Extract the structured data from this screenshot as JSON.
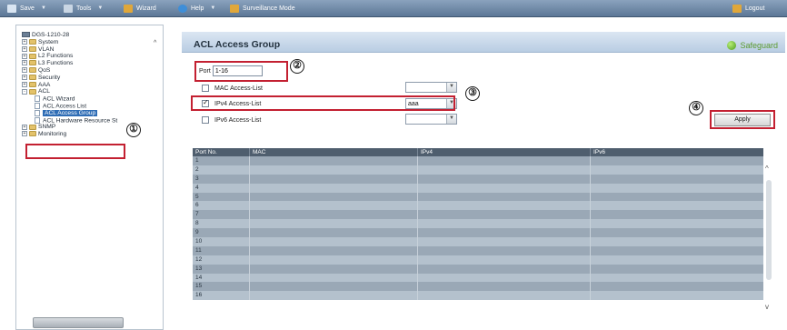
{
  "toolbar": {
    "save": "Save",
    "tools": "Tools",
    "wizard": "Wizard",
    "help": "Help",
    "surveillance": "Surveillance Mode",
    "logout": "Logout"
  },
  "tree": [
    {
      "label": "DGS-1210-28",
      "indent": 0,
      "icon": "device"
    },
    {
      "label": "System",
      "indent": 0,
      "icon": "folder",
      "pm": "+"
    },
    {
      "label": "VLAN",
      "indent": 0,
      "icon": "folder",
      "pm": "+"
    },
    {
      "label": "L2 Functions",
      "indent": 0,
      "icon": "folder",
      "pm": "+"
    },
    {
      "label": "L3 Functions",
      "indent": 0,
      "icon": "folder",
      "pm": "+"
    },
    {
      "label": "QoS",
      "indent": 0,
      "icon": "folder",
      "pm": "+"
    },
    {
      "label": "Security",
      "indent": 0,
      "icon": "folder",
      "pm": "+"
    },
    {
      "label": "AAA",
      "indent": 0,
      "icon": "folder",
      "pm": "+"
    },
    {
      "label": "ACL",
      "indent": 0,
      "icon": "folder",
      "pm": "-"
    },
    {
      "label": "ACL Wizard",
      "indent": 1,
      "icon": "doc"
    },
    {
      "label": "ACL Access List",
      "indent": 1,
      "icon": "doc"
    },
    {
      "label": "ACL Access Group",
      "indent": 1,
      "icon": "doc",
      "selected": true
    },
    {
      "label": "ACL Hardware Resource St",
      "indent": 1,
      "icon": "doc"
    },
    {
      "label": "SNMP",
      "indent": 0,
      "icon": "folder",
      "pm": "+"
    },
    {
      "label": "Monitoring",
      "indent": 0,
      "icon": "folder",
      "pm": "+"
    }
  ],
  "page": {
    "title": "ACL Access Group",
    "safeguard": "Safeguard"
  },
  "form": {
    "port_label": "Port",
    "port_value": "1-16",
    "mac_label": "MAC Access-List",
    "ipv4_label": "IPv4 Access-List",
    "ipv4_value": "aaa",
    "ipv6_label": "IPv6 Access-List",
    "apply_label": "Apply"
  },
  "annotations": [
    "①",
    "②",
    "③",
    "④"
  ],
  "table": {
    "headers": [
      "Port No.",
      "MAC",
      "IPv4",
      "IPv6"
    ],
    "rows": [
      "1",
      "2",
      "3",
      "4",
      "5",
      "6",
      "7",
      "8",
      "9",
      "10",
      "11",
      "12",
      "13",
      "14",
      "15",
      "16"
    ]
  },
  "colors": {
    "annotation_red": "#c32031",
    "selected_blue": "#2f6db5",
    "safeguard_green": "#5b9a2f"
  }
}
